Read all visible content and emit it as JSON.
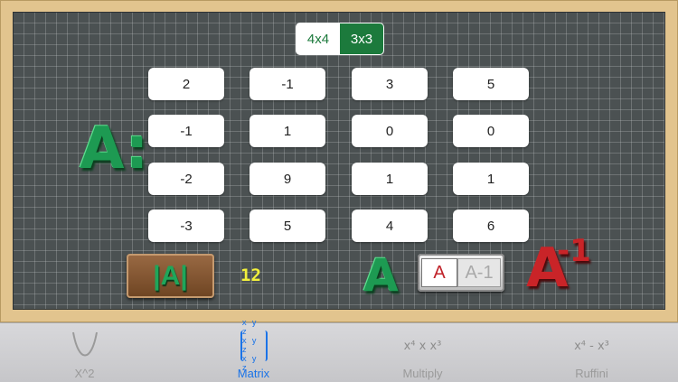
{
  "size_selector": {
    "options": [
      "4x4",
      "3x3"
    ],
    "selected": "3x3"
  },
  "matrix": {
    "label": "A:",
    "rows": [
      [
        "2",
        "-1",
        "3",
        "5"
      ],
      [
        "-1",
        "1",
        "0",
        "0"
      ],
      [
        "-2",
        "9",
        "1",
        "1"
      ],
      [
        "-3",
        "5",
        "4",
        "6"
      ]
    ]
  },
  "controls": {
    "determinant_label": "|A|",
    "determinant_value": "12",
    "current_matrix_label": "A",
    "toggle_options": [
      "A",
      "A-1"
    ],
    "toggle_selected": "A",
    "inverse_base": "A",
    "inverse_exponent": "-1"
  },
  "tabbar": {
    "tabs": [
      {
        "label": "X^2",
        "icon": "parabola-icon"
      },
      {
        "label": "Matrix",
        "icon": "matrix-icon",
        "icon_text": [
          "x y z",
          "x y z",
          "x y z"
        ]
      },
      {
        "label": "Multiply",
        "icon": "multiply-icon",
        "icon_text": "x⁴ x x³"
      },
      {
        "label": "Ruffini",
        "icon": "ruffini-icon",
        "icon_text": "x⁴ - x³"
      }
    ],
    "selected": "Matrix"
  },
  "colors": {
    "accent_green": "#1c7a3c",
    "label_green": "#1d9a52",
    "inverse_red": "#c92428",
    "determinant_yellow": "#f2f03c",
    "tab_selected": "#1a73e8"
  }
}
